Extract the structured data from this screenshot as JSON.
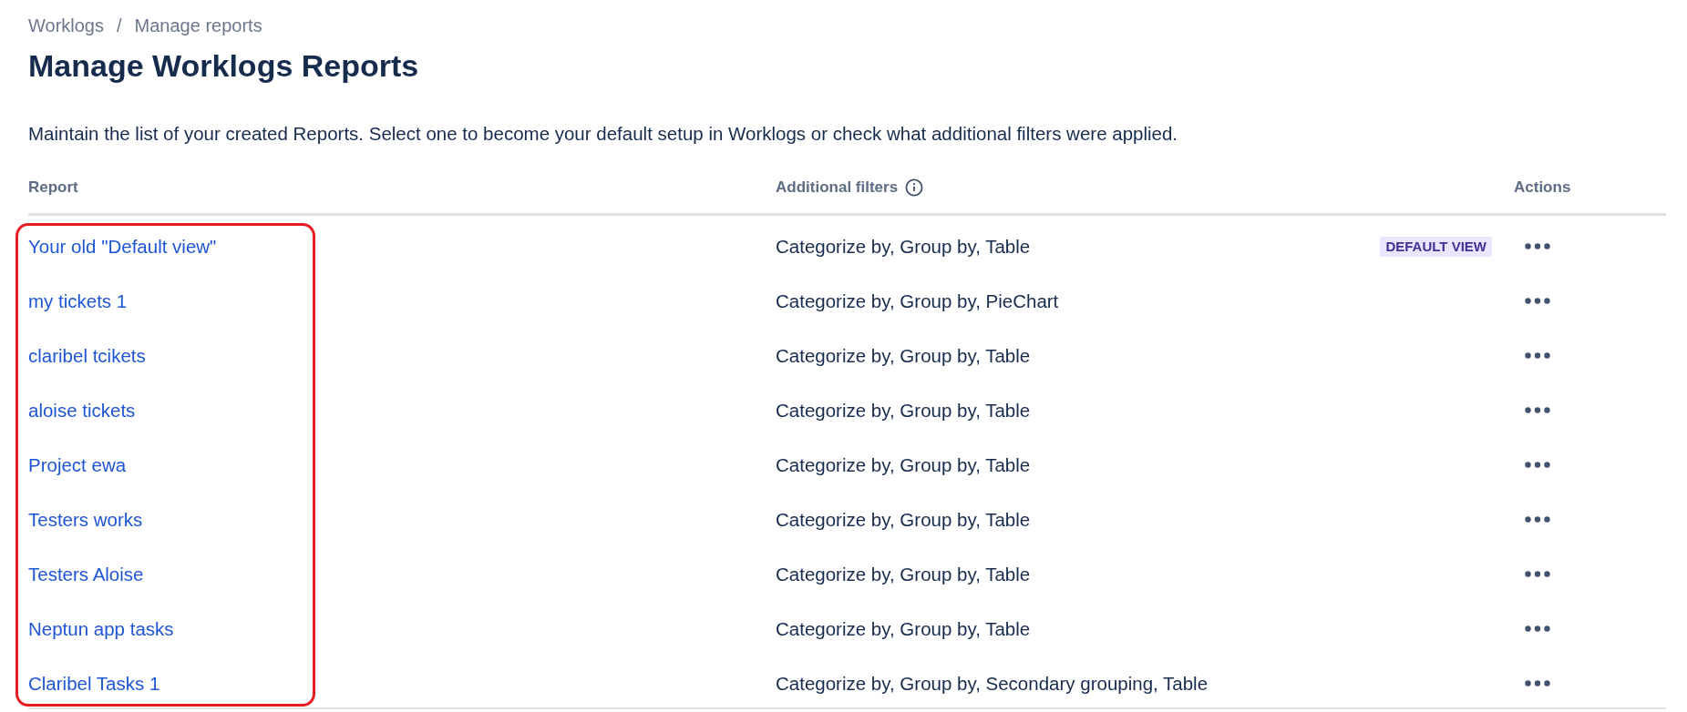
{
  "breadcrumbs": [
    {
      "label": "Worklogs"
    },
    {
      "label": "Manage reports"
    }
  ],
  "breadcrumb_separator": "/",
  "title": "Manage Worklogs Reports",
  "description": "Maintain the list of your created Reports. Select one to become your default setup in Worklogs or check what additional filters were applied.",
  "table": {
    "columns": [
      {
        "label": "Report",
        "info_icon": false,
        "highlighted": true
      },
      {
        "label": "Additional filters",
        "info_icon": true,
        "highlighted": false
      },
      {
        "label": "Actions",
        "info_icon": false,
        "highlighted": false
      }
    ],
    "rows": [
      {
        "report": "Your old \"Default view\"",
        "filters": "Categorize by, Group by, Table",
        "badge": "DEFAULT VIEW"
      },
      {
        "report": "my tickets 1",
        "filters": "Categorize by, Group by, PieChart"
      },
      {
        "report": "claribel tcikets",
        "filters": "Categorize by, Group by, Table"
      },
      {
        "report": "aloise tickets",
        "filters": "Categorize by, Group by, Table"
      },
      {
        "report": "Project ewa",
        "filters": "Categorize by, Group by, Table"
      },
      {
        "report": "Testers works",
        "filters": "Categorize by, Group by, Table"
      },
      {
        "report": "Testers Aloise",
        "filters": "Categorize by, Group by, Table"
      },
      {
        "report": "Neptun app tasks",
        "filters": "Categorize by, Group by, Table"
      },
      {
        "report": "Claribel Tasks 1",
        "filters": "Categorize by, Group by, Secondary grouping, Table"
      }
    ]
  }
}
